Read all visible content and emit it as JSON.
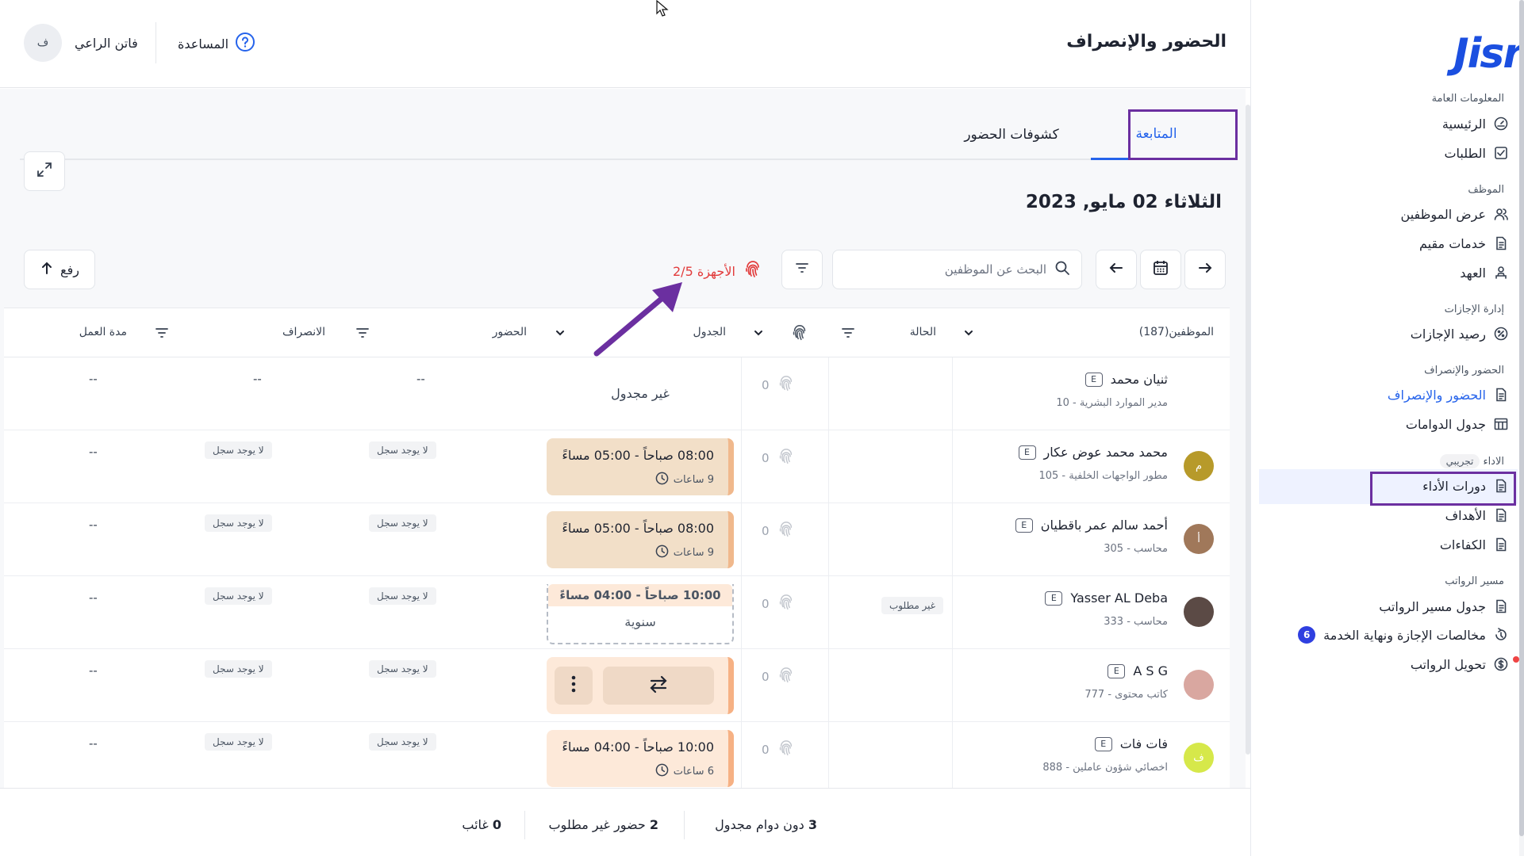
{
  "header": {
    "title": "الحضور والإنصراف",
    "help_label": "المساعدة",
    "user_name": "فاتن الراعي",
    "user_initial": "ف"
  },
  "sidebar": {
    "logo": "Jisr",
    "sections": [
      {
        "label": "المعلومات العامة",
        "items": [
          {
            "label": "الرئيسية",
            "icon": "gauge-icon"
          },
          {
            "label": "الطلبات",
            "icon": "checkbox-icon"
          }
        ]
      },
      {
        "label": "الموظف",
        "items": [
          {
            "label": "عرض الموظفين",
            "icon": "users-icon"
          },
          {
            "label": "خدمات مقيم",
            "icon": "document-icon"
          },
          {
            "label": "العهد",
            "icon": "custody-icon"
          }
        ]
      },
      {
        "label": "إدارة الإجازات",
        "items": [
          {
            "label": "رصيد الإجازات",
            "icon": "percent-icon"
          }
        ]
      },
      {
        "label": "الحضور والإنصراف",
        "items": [
          {
            "label": "الحضور والإنصراف",
            "icon": "document-icon",
            "active": true
          },
          {
            "label": "جدول الدوامات",
            "icon": "table-icon"
          }
        ]
      },
      {
        "label": "الاداء",
        "badge": "تجريبي",
        "items": [
          {
            "label": "دورات الأداء",
            "icon": "document-icon"
          },
          {
            "label": "الأهداف",
            "icon": "document-icon"
          },
          {
            "label": "الكفاءات",
            "icon": "document-icon"
          }
        ]
      },
      {
        "label": "مسير الرواتب",
        "items": [
          {
            "label": "جدول مسير الرواتب",
            "icon": "document-icon"
          },
          {
            "label": "مخالصات الإجازة ونهاية الخدمة",
            "icon": "settlement-icon",
            "count": "6"
          },
          {
            "label": "تحويل الرواتب",
            "icon": "dollar-icon"
          }
        ]
      }
    ]
  },
  "tabs": [
    {
      "label": "المتابعة",
      "active": true
    },
    {
      "label": "كشوفات الحضور",
      "active": false
    }
  ],
  "date_label": "الثلاثاء 02 مايو, 2023",
  "search": {
    "placeholder": "البحث عن الموظفين"
  },
  "devices_label": "2/5 الأجهزة",
  "upload_label": "رفع",
  "table": {
    "headers": {
      "employees": "الموظفين(187)",
      "status": "الحالة",
      "schedule": "الجدول",
      "check_in": "الحضور",
      "check_out": "الانصراف",
      "duration": "مدة العمل"
    },
    "rows": [
      {
        "name": "ثنيان محمد",
        "sub": "مدير الموارد البشرية - 10",
        "avatar": "",
        "avatar_color": "",
        "status": "",
        "punches": "0",
        "schedule_type": "none",
        "schedule_text": "غير مجدول",
        "check_in": "--",
        "check_out": "--",
        "duration": "--"
      },
      {
        "name": "محمد محمد عوض عكار",
        "sub": "مطور الواجهات الخلفية - 105",
        "avatar": "م",
        "avatar_color": "#b79a2a",
        "status": "",
        "punches": "0",
        "schedule_type": "card",
        "schedule_time": "08:00 صباحاً - 05:00 مساءً",
        "schedule_hours": "9 ساعات",
        "check_in": "لا يوجد سجل",
        "check_out": "لا يوجد سجل",
        "duration": "--"
      },
      {
        "name": "أحمد سالم عمر باقطيان",
        "sub": "محاسب - 305",
        "avatar": "أ",
        "avatar_color": "#a0785a",
        "status": "",
        "punches": "0",
        "schedule_type": "card",
        "schedule_time": "08:00 صباحاً - 05:00 مساءً",
        "schedule_hours": "9 ساعات",
        "check_in": "لا يوجد سجل",
        "check_out": "لا يوجد سجل",
        "duration": "--"
      },
      {
        "name": "Yasser AL Deba",
        "sub": "محاسب - 333",
        "avatar": "",
        "avatar_color": "#5b4a45",
        "status": "غير مطلوب",
        "punches": "0",
        "schedule_type": "leave",
        "schedule_time": "10:00 صباحاً - 04:00 مساءً",
        "schedule_label": "سنوية",
        "check_in": "لا يوجد سجل",
        "check_out": "لا يوجد سجل",
        "duration": "--"
      },
      {
        "name": "A S G",
        "sub": "كاتب محتوى - 777",
        "avatar": "",
        "avatar_color": "#d9a7a0",
        "status": "",
        "punches": "0",
        "schedule_type": "swap",
        "check_in": "لا يوجد سجل",
        "check_out": "لا يوجد سجل",
        "duration": "--"
      },
      {
        "name": "فات فات",
        "sub": "اخصائي شؤون عاملين - 888",
        "avatar": "ف",
        "avatar_color": "#d6e84a",
        "status": "",
        "punches": "0",
        "schedule_type": "card",
        "schedule_time": "10:00 صباحاً - 04:00 مساءً",
        "schedule_hours": "6 ساعات",
        "check_in": "لا يوجد سجل",
        "check_out": "لا يوجد سجل",
        "duration": "--"
      }
    ]
  },
  "footer": {
    "unscheduled_count": "3",
    "unscheduled_label": "دون دوام مجدول",
    "not_required_count": "2",
    "not_required_label": "حضور غير مطلوب",
    "absent_count": "0",
    "absent_label": "غائب"
  },
  "colors": {
    "accent": "#2563eb",
    "annotation": "#6b2fa0",
    "devices": "#e23b3b"
  }
}
